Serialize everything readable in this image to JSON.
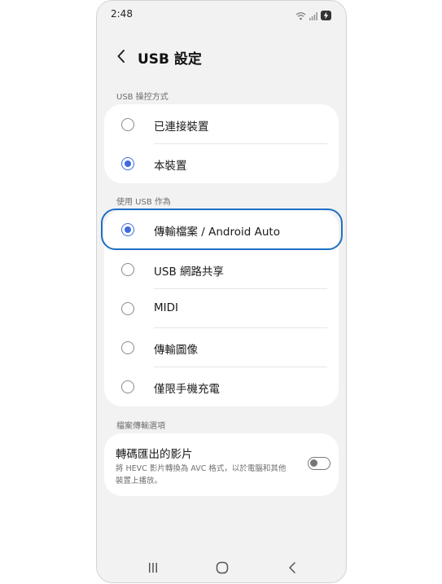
{
  "status_bar": {
    "time": "2:48"
  },
  "header": {
    "title": "USB 設定",
    "back_icon": "chevron-left-icon"
  },
  "usb_control": {
    "section_label": "USB 操控方式",
    "options": [
      {
        "label": "已連接裝置",
        "selected": false
      },
      {
        "label": "本裝置",
        "selected": true
      }
    ]
  },
  "usb_use": {
    "section_label": "使用 USB 作為",
    "options": [
      {
        "label": "傳輸檔案 / Android Auto",
        "selected": true
      },
      {
        "label": "USB 網路共享",
        "selected": false
      },
      {
        "label": "MIDI",
        "selected": false
      },
      {
        "label": "傳輸圖像",
        "selected": false
      },
      {
        "label": "僅限手機充電",
        "selected": false
      }
    ]
  },
  "file_transfer": {
    "section_label": "檔案傳輸選項",
    "transcode": {
      "title": "轉碼匯出的影片",
      "description": "將 HEVC 影片轉換為 AVC 格式，以於電腦和其他裝置上播放。",
      "enabled": false
    }
  },
  "colors": {
    "accent": "#3e6be0",
    "highlight": "#1f6fc5",
    "background": "#f2f2f2"
  }
}
